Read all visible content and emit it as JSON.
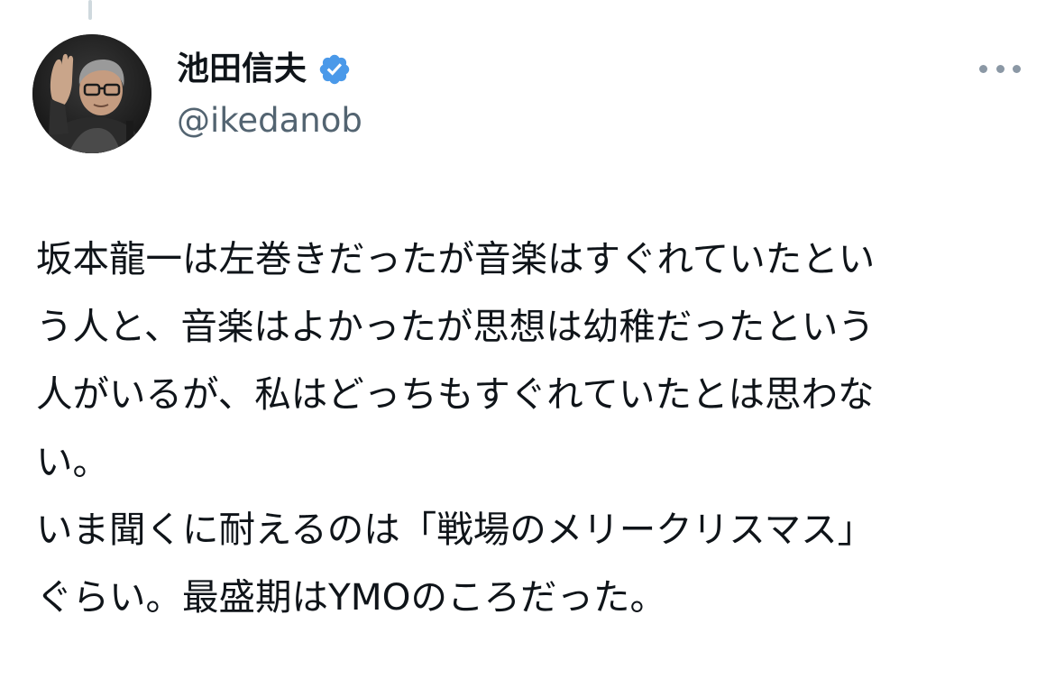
{
  "tweet": {
    "author": {
      "display_name": "池田信夫",
      "handle": "@ikedanob",
      "verified": true,
      "avatar_icon": "user-avatar-photo"
    },
    "menu_icon": "more-horizontal-icon",
    "verified_icon": "verified-badge-icon",
    "colors": {
      "verified": "#4a99e9",
      "handle": "#536471",
      "text": "#0f1419"
    },
    "text_lines": [
      "坂本龍一は左巻きだったが音楽はすぐれていたとい",
      "う人と、音楽はよかったが思想は幼稚だったという",
      "人がいるが、私はどっちもすぐれていたとは思わな",
      "い。",
      "いま聞くに耐えるのは「戦場のメリークリスマス」",
      "ぐらい。最盛期はYMOのころだった。"
    ]
  }
}
